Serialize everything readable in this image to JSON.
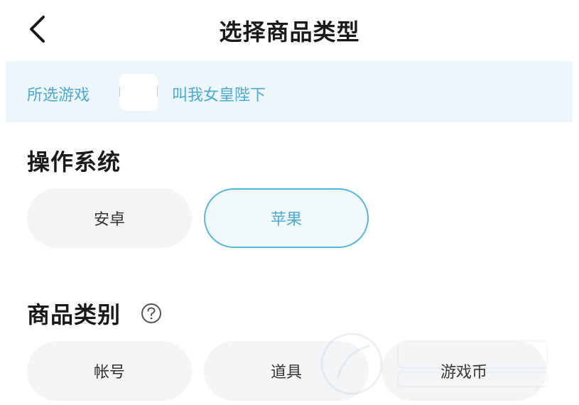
{
  "header": {
    "title": "选择商品类型",
    "back_icon": "chevron-left-icon"
  },
  "banner": {
    "label": "所选游戏",
    "game_name": "叫我女皇陛下"
  },
  "os_section": {
    "title": "操作系统",
    "options": [
      {
        "label": "安卓",
        "selected": false
      },
      {
        "label": "苹果",
        "selected": true
      }
    ]
  },
  "category_section": {
    "title": "商品类别",
    "help_icon": "question-circle-icon",
    "options": [
      {
        "label": "帐号",
        "selected": false
      },
      {
        "label": "道具",
        "selected": false
      },
      {
        "label": "游戏币",
        "selected": false
      }
    ]
  },
  "colors": {
    "accent": "#4aa9d6",
    "accent_border": "#56b7dc",
    "banner_bg": "#eef7fb",
    "pill_bg": "#f3f5f7"
  }
}
